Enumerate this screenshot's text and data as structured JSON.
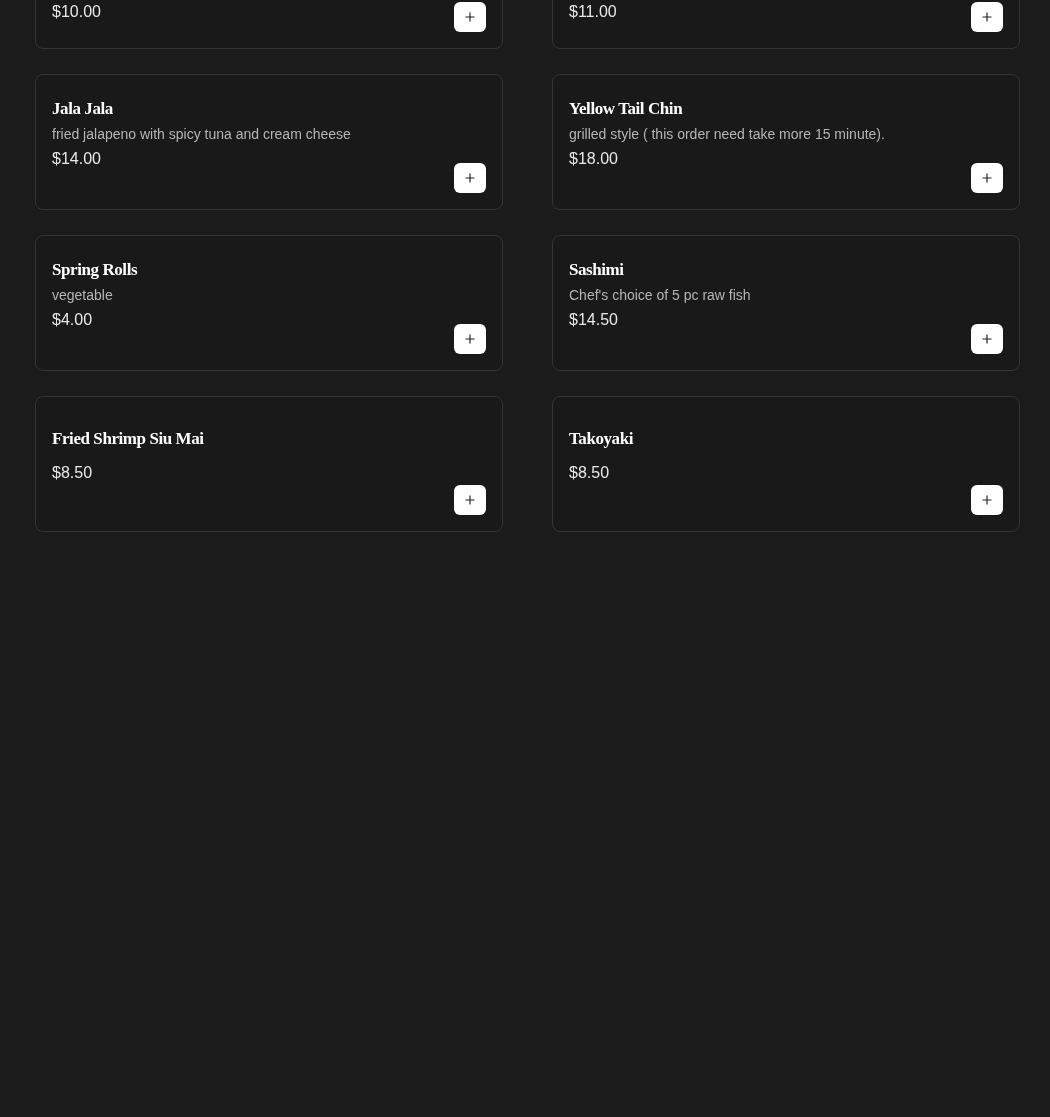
{
  "items": [
    {
      "price": "$10.00"
    },
    {
      "price": "$11.00"
    },
    {
      "title": "Jala Jala",
      "description": "fried jalapeno with spicy tuna and cream cheese",
      "price": "$14.00"
    },
    {
      "title": "Yellow Tail Chin",
      "description": "grilled style ( this order need take more 15 minute).",
      "price": "$18.00"
    },
    {
      "title": "Spring Rolls",
      "description": "vegetable",
      "price": "$4.00"
    },
    {
      "title": "Sashimi",
      "description": "Chef's choice of 5 pc raw fish",
      "price": "$14.50"
    },
    {
      "title": "Fried Shrimp Siu Mai",
      "price": "$8.50"
    },
    {
      "title": "Takoyaki",
      "price": "$8.50"
    }
  ]
}
